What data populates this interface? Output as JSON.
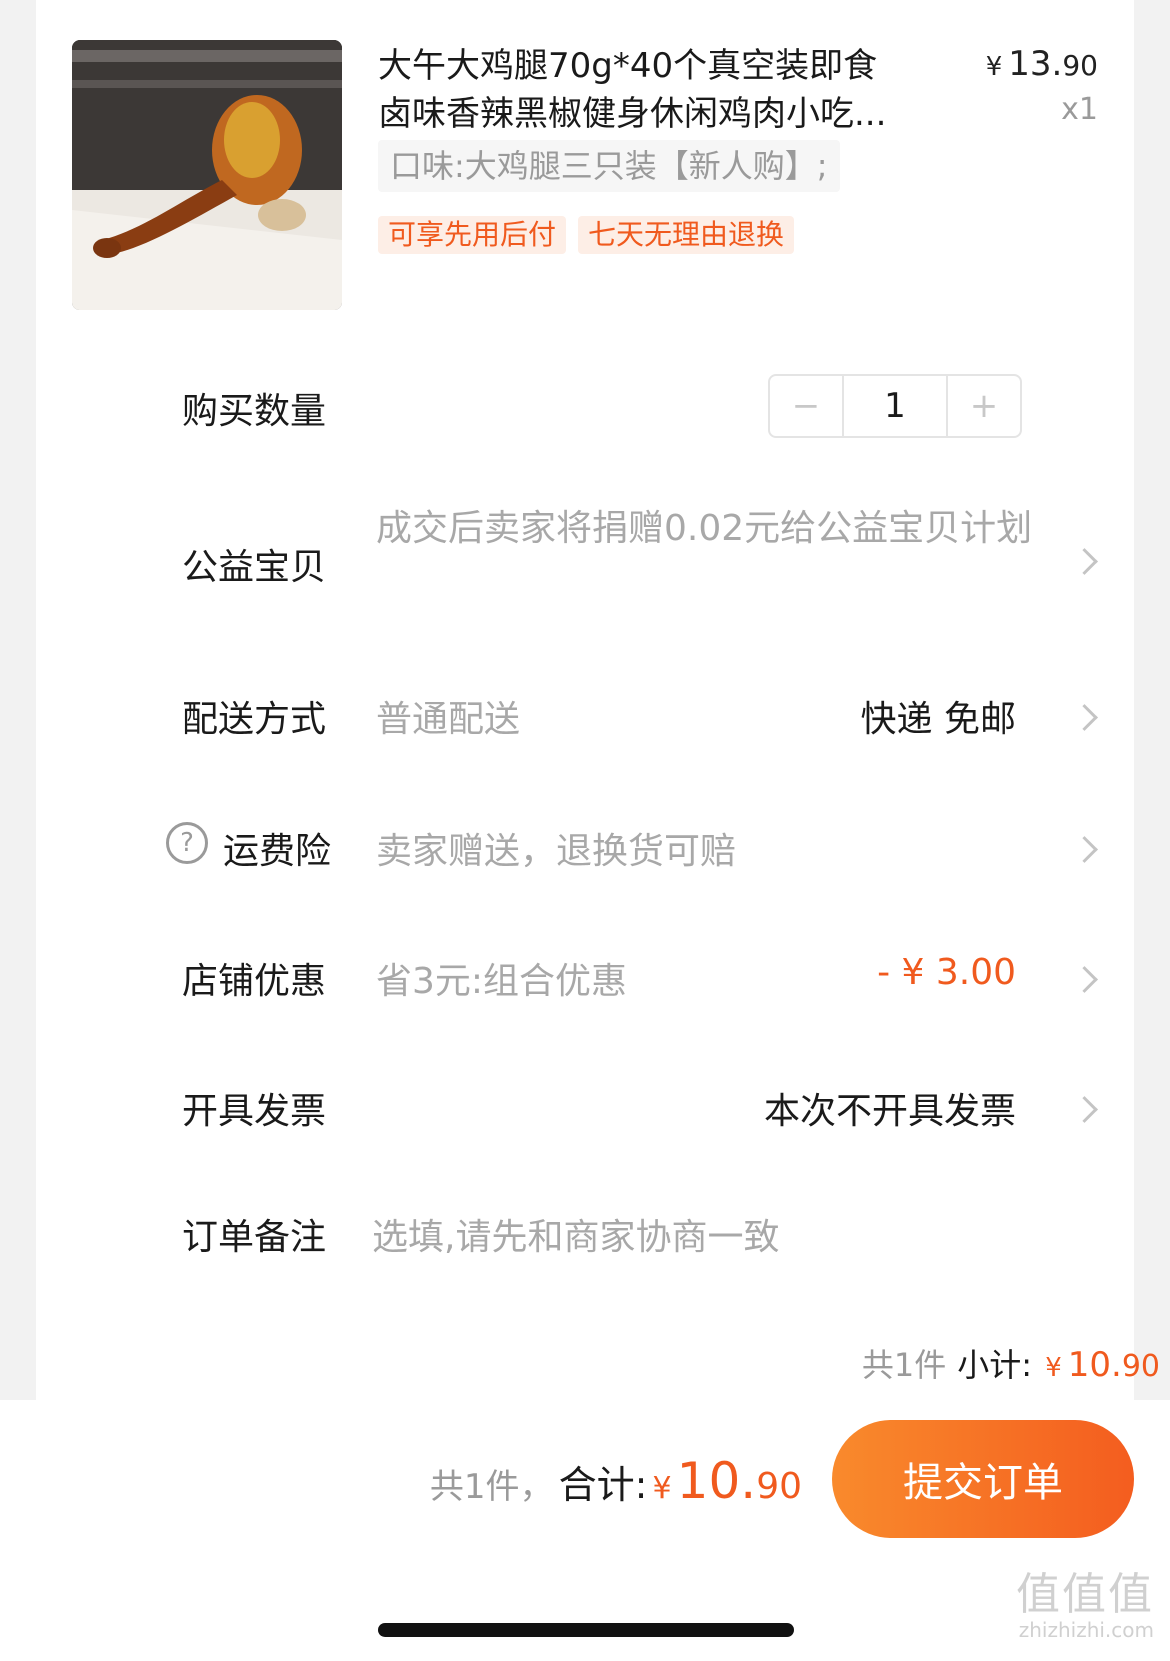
{
  "product": {
    "title_line1": "大午大鸡腿70g*40个真空装即食",
    "title_line2": "卤味香辣黑椒健身休闲鸡肉小吃...",
    "price_symbol": "¥",
    "price_int": "13.",
    "price_dec": "90",
    "quantity_label": "x1",
    "sku": "口味:大鸡腿三只装【新人购】;",
    "tags": [
      "可享先用后付",
      "七天无理由退换"
    ]
  },
  "rows": {
    "quantity": {
      "label": "购买数量",
      "value": "1",
      "minus": "−",
      "plus": "+"
    },
    "charity": {
      "label": "公益宝贝",
      "value": "成交后卖家将捐赠0.02元给公益宝贝计划"
    },
    "delivery": {
      "label": "配送方式",
      "value": "普通配送",
      "right": "快递 免邮"
    },
    "insurance": {
      "label": "运费险",
      "value": "卖家赠送，退换货可赔",
      "icon": "?"
    },
    "discount": {
      "label": "店铺优惠",
      "value": "省3元:组合优惠",
      "right": "- ¥ 3.00"
    },
    "invoice": {
      "label": "开具发票",
      "right": "本次不开具发票"
    },
    "note": {
      "label": "订单备注",
      "placeholder": "选填,请先和商家协商一致"
    }
  },
  "subtotal": {
    "count": "共1件",
    "label": "小计:",
    "symbol": "¥",
    "int": "10.",
    "dec": "90"
  },
  "footer": {
    "count": "共1件，",
    "label": "合计:",
    "symbol": "¥",
    "int": "10.",
    "dec": "90",
    "submit": "提交订单"
  },
  "watermark": {
    "big": "值值值",
    "small": "zhizhizhi.com"
  },
  "colors": {
    "accent": "#f05a1e",
    "submit_start": "#f98a2c",
    "submit_end": "#f45d1f"
  }
}
